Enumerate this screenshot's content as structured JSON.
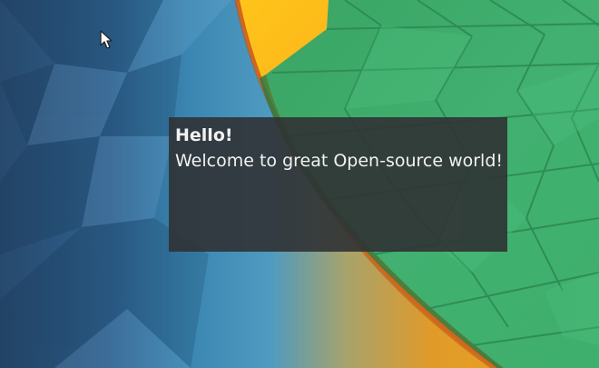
{
  "desktop": {
    "colors": {
      "background_dark": "#2a4f72",
      "background_mid": "#3b86b0",
      "band_yellow": "#f6b516",
      "band_orange": "#e07a1c",
      "green_surface": "#3fae6d",
      "green_dark": "#2f8c56"
    }
  },
  "cursor": {
    "icon": "arrow-pointer-icon"
  },
  "notification": {
    "title": "Hello!",
    "body": "Welcome to great Open-source world!",
    "background": "#303234"
  }
}
